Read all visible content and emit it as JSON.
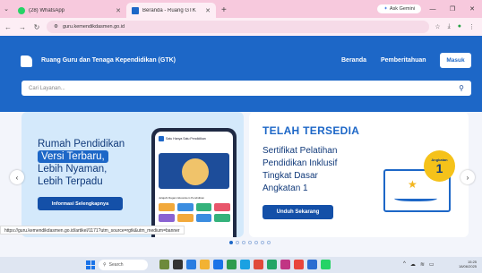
{
  "browser": {
    "tabs": [
      {
        "title": "(28) WhatsApp",
        "active": false
      },
      {
        "title": "Beranda - Ruang GTK",
        "active": true
      }
    ],
    "gemini_label": "Ask Gemini",
    "url": "guru.kemendikdasmen.go.id",
    "status_url": "https://guru.kemendikdasmen.go.id/artikel/1171?utm_source=rgtk&utm_medium=banner"
  },
  "header": {
    "site_title": "Ruang Guru dan Tenaga Kependidikan (GTK)",
    "nav_beranda": "Beranda",
    "nav_pemberitahuan": "Pemberitahuan",
    "login_label": "Masuk"
  },
  "search": {
    "placeholder": "Cari Layanan..."
  },
  "banner_left": {
    "line1": "Rumah Pendidikan",
    "highlight": "Versi Terbaru,",
    "line3": "Lebih Nyaman,",
    "line4": "Lebih Terpadu",
    "button": "Informasi Selengkapnya",
    "phone_header": "Satu Hanya Satu Pendidikan",
    "phone_section": "Jelajahi Ragam Ekosistem Pendidikan"
  },
  "banner_right": {
    "title": "TELAH TERSEDIA",
    "line1": "Sertifikat Pelatihan",
    "line2": "Pendidikan Inklusif",
    "line3": "Tingkat Dasar",
    "line4": "Angkatan 1",
    "button": "Unduh Sekarang",
    "badge_text": "Angkatan",
    "badge_number": "1"
  },
  "carousel": {
    "dot_count": 7,
    "active_index": 0
  },
  "taskbar": {
    "search_label": "Search",
    "clock_time": "15:25",
    "clock_date": "18/06/2025"
  },
  "colors": {
    "brand_blue": "#1d67c7",
    "dark_blue": "#113a7a",
    "badge_yellow": "#f5c21a",
    "tab_strip_pink": "#f7c9dd"
  }
}
